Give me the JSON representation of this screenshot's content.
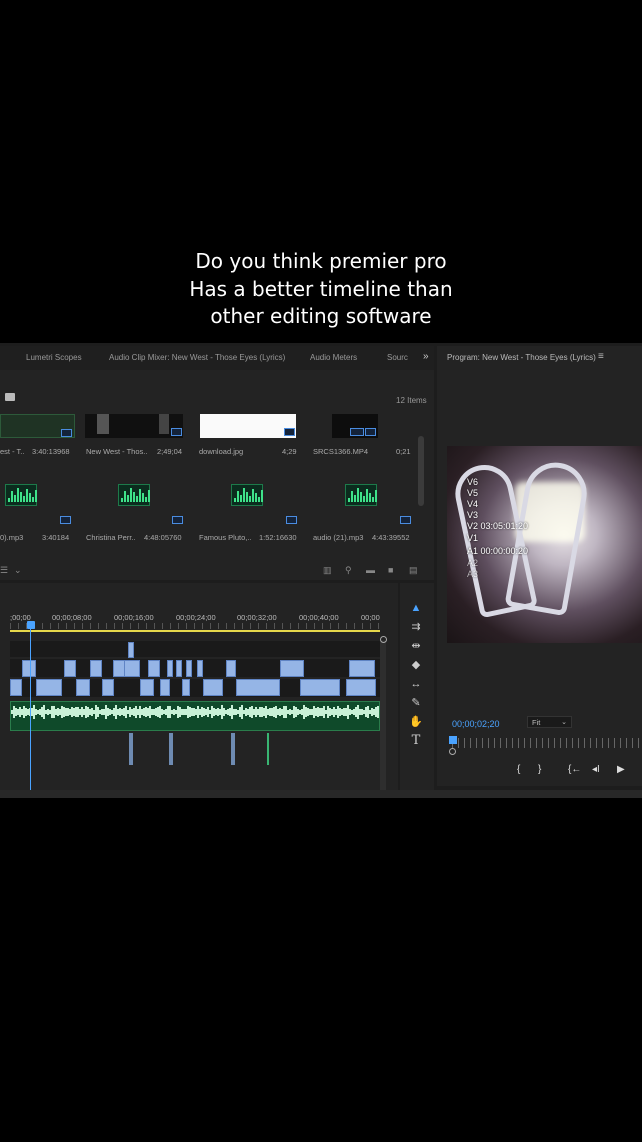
{
  "caption": {
    "line1": "Do you think premier pro",
    "line2": "Has a better timeline than",
    "line3": "other editing software"
  },
  "tabs": [
    "Lumetri Scopes",
    "Audio Clip Mixer: New West - Those Eyes (Lyrics)",
    "Audio Meters",
    "Sourc"
  ],
  "more_tabs": "»",
  "project": {
    "items_count": "12 Items",
    "clips": [
      {
        "name": "est - T..",
        "duration": "3:40:13968"
      },
      {
        "name": "New West - Thos..",
        "duration": "2;49;04"
      },
      {
        "name": "download.jpg",
        "duration": "4;29"
      },
      {
        "name": "SRCS1366.MP4",
        "duration": "0;21"
      },
      {
        "name": "0).mp3",
        "duration": "3:40184"
      },
      {
        "name": "Christina Perr..",
        "duration": "4:48:05760"
      },
      {
        "name": "Famous Pluto,..",
        "duration": "1:52:16630"
      },
      {
        "name": "audio (21).mp3",
        "duration": "4:43:39552"
      }
    ]
  },
  "timeline": {
    "ruler": [
      ";00;00",
      "00;00;08;00",
      "00;00;16;00",
      "00;00;24;00",
      "00;00;32;00",
      "00;00;40;00",
      "00;00"
    ]
  },
  "program": {
    "title": "Program: New West - Those Eyes (Lyrics)",
    "menu_icon": "≡",
    "timecode": "00;00;02;20",
    "zoom": "Fit",
    "overlay_lines": [
      "V6",
      "V5",
      "V4",
      "V3",
      "V2 03:05:01:20",
      "V1",
      "A1 00:00:00:20",
      "A2",
      "A3"
    ]
  },
  "transport": {
    "mark_in": "{",
    "mark_out": "}",
    "go_to_in": "{←",
    "step_back": "◂I",
    "play": "▶"
  },
  "icons": {
    "selection": "selection-tool-icon",
    "track_select": "track-select-icon",
    "ripple": "ripple-edit-icon",
    "razor": "razor-icon",
    "slip": "slip-icon",
    "pen": "pen-icon",
    "hand": "hand-icon",
    "type": "type-icon"
  },
  "colors": {
    "accent": "#4aa3ff",
    "video_clip": "#95b5e6",
    "audio_clip": "#0f4a2a",
    "in_out_bar": "#e6d84b"
  }
}
